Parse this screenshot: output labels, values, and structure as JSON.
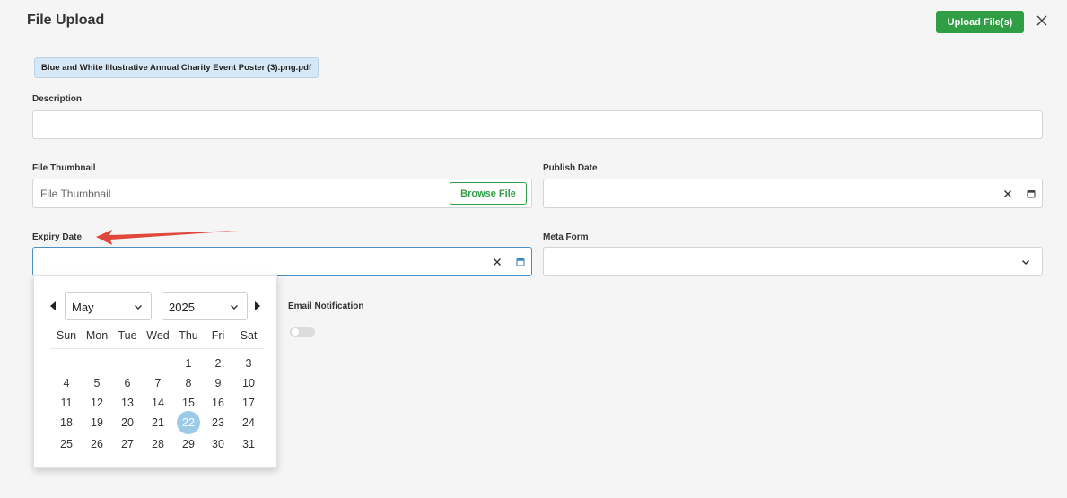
{
  "header": {
    "title": "File Upload",
    "upload_label": "Upload File(s)"
  },
  "file": {
    "name": "Blue and White Illustrative Annual Charity Event Poster (3).png.pdf"
  },
  "form": {
    "description_label": "Description",
    "description_value": "",
    "thumbnail_label": "File Thumbnail",
    "thumbnail_placeholder": "File Thumbnail",
    "browse_label": "Browse File",
    "publish_label": "Publish Date",
    "publish_value": "",
    "expiry_label": "Expiry Date",
    "expiry_value": "",
    "meta_label": "Meta Form",
    "meta_value": "",
    "email_label": "Email Notification",
    "email_enabled": false
  },
  "datepicker": {
    "month": "May",
    "year": "2025",
    "weekdays": [
      "Sun",
      "Mon",
      "Tue",
      "Wed",
      "Thu",
      "Fri",
      "Sat"
    ],
    "first_weekday_index": 4,
    "days_in_month": 31,
    "selected_day": 22
  },
  "colors": {
    "primary_green": "#2f9e44",
    "selected_day": "#9ccbe9",
    "arrow_red": "#e0483b"
  }
}
